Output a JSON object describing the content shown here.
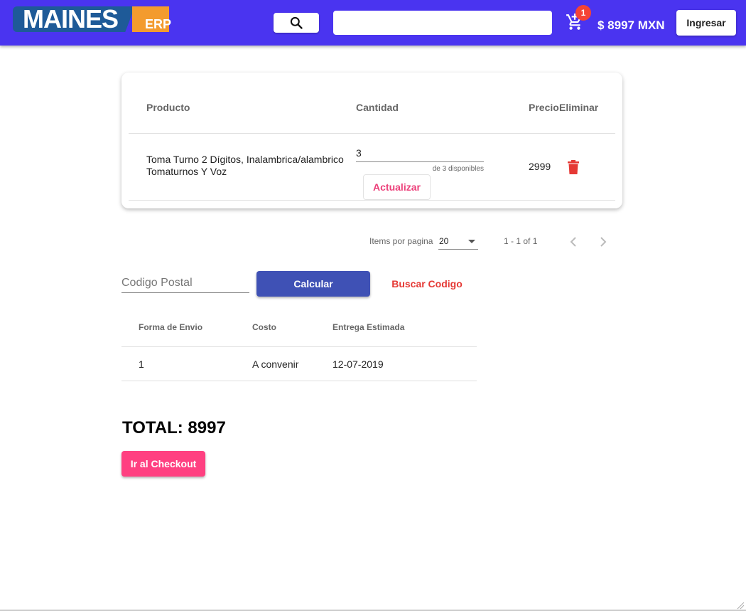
{
  "header": {
    "logo_text": "MAINES",
    "logo_suffix": "ERP",
    "search_placeholder": "",
    "cart_count": "1",
    "cart_total": "$ 8997 MXN",
    "login_label": "Ingresar"
  },
  "cart_table": {
    "headers": {
      "product": "Producto",
      "quantity": "Cantidad",
      "price": "Precio",
      "remove": "Eliminar"
    },
    "rows": [
      {
        "product": "Toma Turno 2 Dígitos, Inalambrica/alambrico Tomaturnos Y Voz",
        "quantity": "3",
        "available": "de 3 disponibles",
        "update_label": "Actualizar",
        "price": "2999"
      }
    ]
  },
  "paginator": {
    "items_per_page_label": "Items por pagina",
    "page_size": "20",
    "range": "1 - 1 of 1"
  },
  "shipping": {
    "postal_placeholder": "Codigo Postal",
    "calculate_label": "Calcular",
    "find_code_label": "Buscar Codigo",
    "headers": {
      "method": "Forma de Envio",
      "cost": "Costo",
      "eta": "Entrega Estimada"
    },
    "rows": [
      {
        "method": "1",
        "cost": "A convenir",
        "eta": "12-07-2019"
      }
    ]
  },
  "total_label": "TOTAL: 8997",
  "checkout_label": "Ir al Checkout",
  "colors": {
    "header_bg": "#4a34f0",
    "primary": "#3f51b5",
    "accent": "#ff4081",
    "danger": "#e53935"
  }
}
